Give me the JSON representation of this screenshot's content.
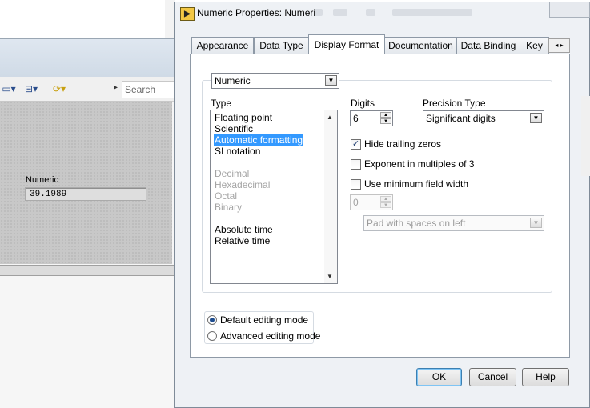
{
  "background_window": {
    "search_placeholder": "Search",
    "numeric_label": "Numeric",
    "numeric_value": "39.1989"
  },
  "dialog": {
    "title": "Numeric Properties: Numeric",
    "tabs": [
      "Appearance",
      "Data Type",
      "Display Format",
      "Documentation",
      "Data Binding",
      "Key"
    ],
    "active_tab": "Display Format",
    "format_select": "Numeric",
    "type_label": "Type",
    "type_list": {
      "group1": [
        "Floating point",
        "Scientific",
        "Automatic formatting",
        "SI notation"
      ],
      "group2": [
        "Decimal",
        "Hexadecimal",
        "Octal",
        "Binary"
      ],
      "group3": [
        "Absolute time",
        "Relative time"
      ],
      "selected": "Automatic formatting"
    },
    "digits_label": "Digits",
    "digits_value": "6",
    "precision_label": "Precision Type",
    "precision_value": "Significant digits",
    "hide_trailing_zeros": "Hide trailing zeros",
    "hide_trailing_zeros_checked": true,
    "exponent_multiples": "Exponent in multiples of 3",
    "exponent_multiples_checked": false,
    "use_min_width": "Use minimum field width",
    "use_min_width_checked": false,
    "min_width_value": "0",
    "pad_value": "Pad with spaces on left",
    "modes": {
      "default": "Default editing mode",
      "advanced": "Advanced editing mode",
      "selected": "default"
    },
    "buttons": {
      "ok": "OK",
      "cancel": "Cancel",
      "help": "Help"
    }
  },
  "colors": {
    "selection": "#3399ff",
    "disabled_text": "#a4a4a4"
  }
}
